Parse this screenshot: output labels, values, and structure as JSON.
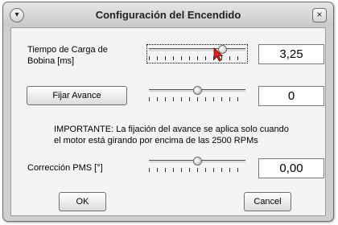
{
  "window": {
    "title": "Configuración del Encendido",
    "menu_icon": "chevron-down-icon",
    "close_icon": "close-icon",
    "close_glyph": "×",
    "menu_glyph": "▾"
  },
  "coil": {
    "label_line1": "Tiempo de Carga de",
    "label_line2": "Bobina [ms]",
    "slider_value": 0.78,
    "value": "3,25"
  },
  "advance": {
    "button_label": "Fijar Avance",
    "slider_value": 0.5,
    "value": "0"
  },
  "notice": {
    "line1": "IMPORTANTE: La fijación del avance se aplica solo cuando",
    "line2": "el motor está girando por encima de las 2500 RPMs"
  },
  "pms": {
    "label": "Corrección PMS  [°]",
    "slider_value": 0.5,
    "value": "0,00"
  },
  "footer": {
    "ok_label": "OK",
    "cancel_label": "Cancel"
  },
  "colors": {
    "cursor": "#e0201e"
  }
}
